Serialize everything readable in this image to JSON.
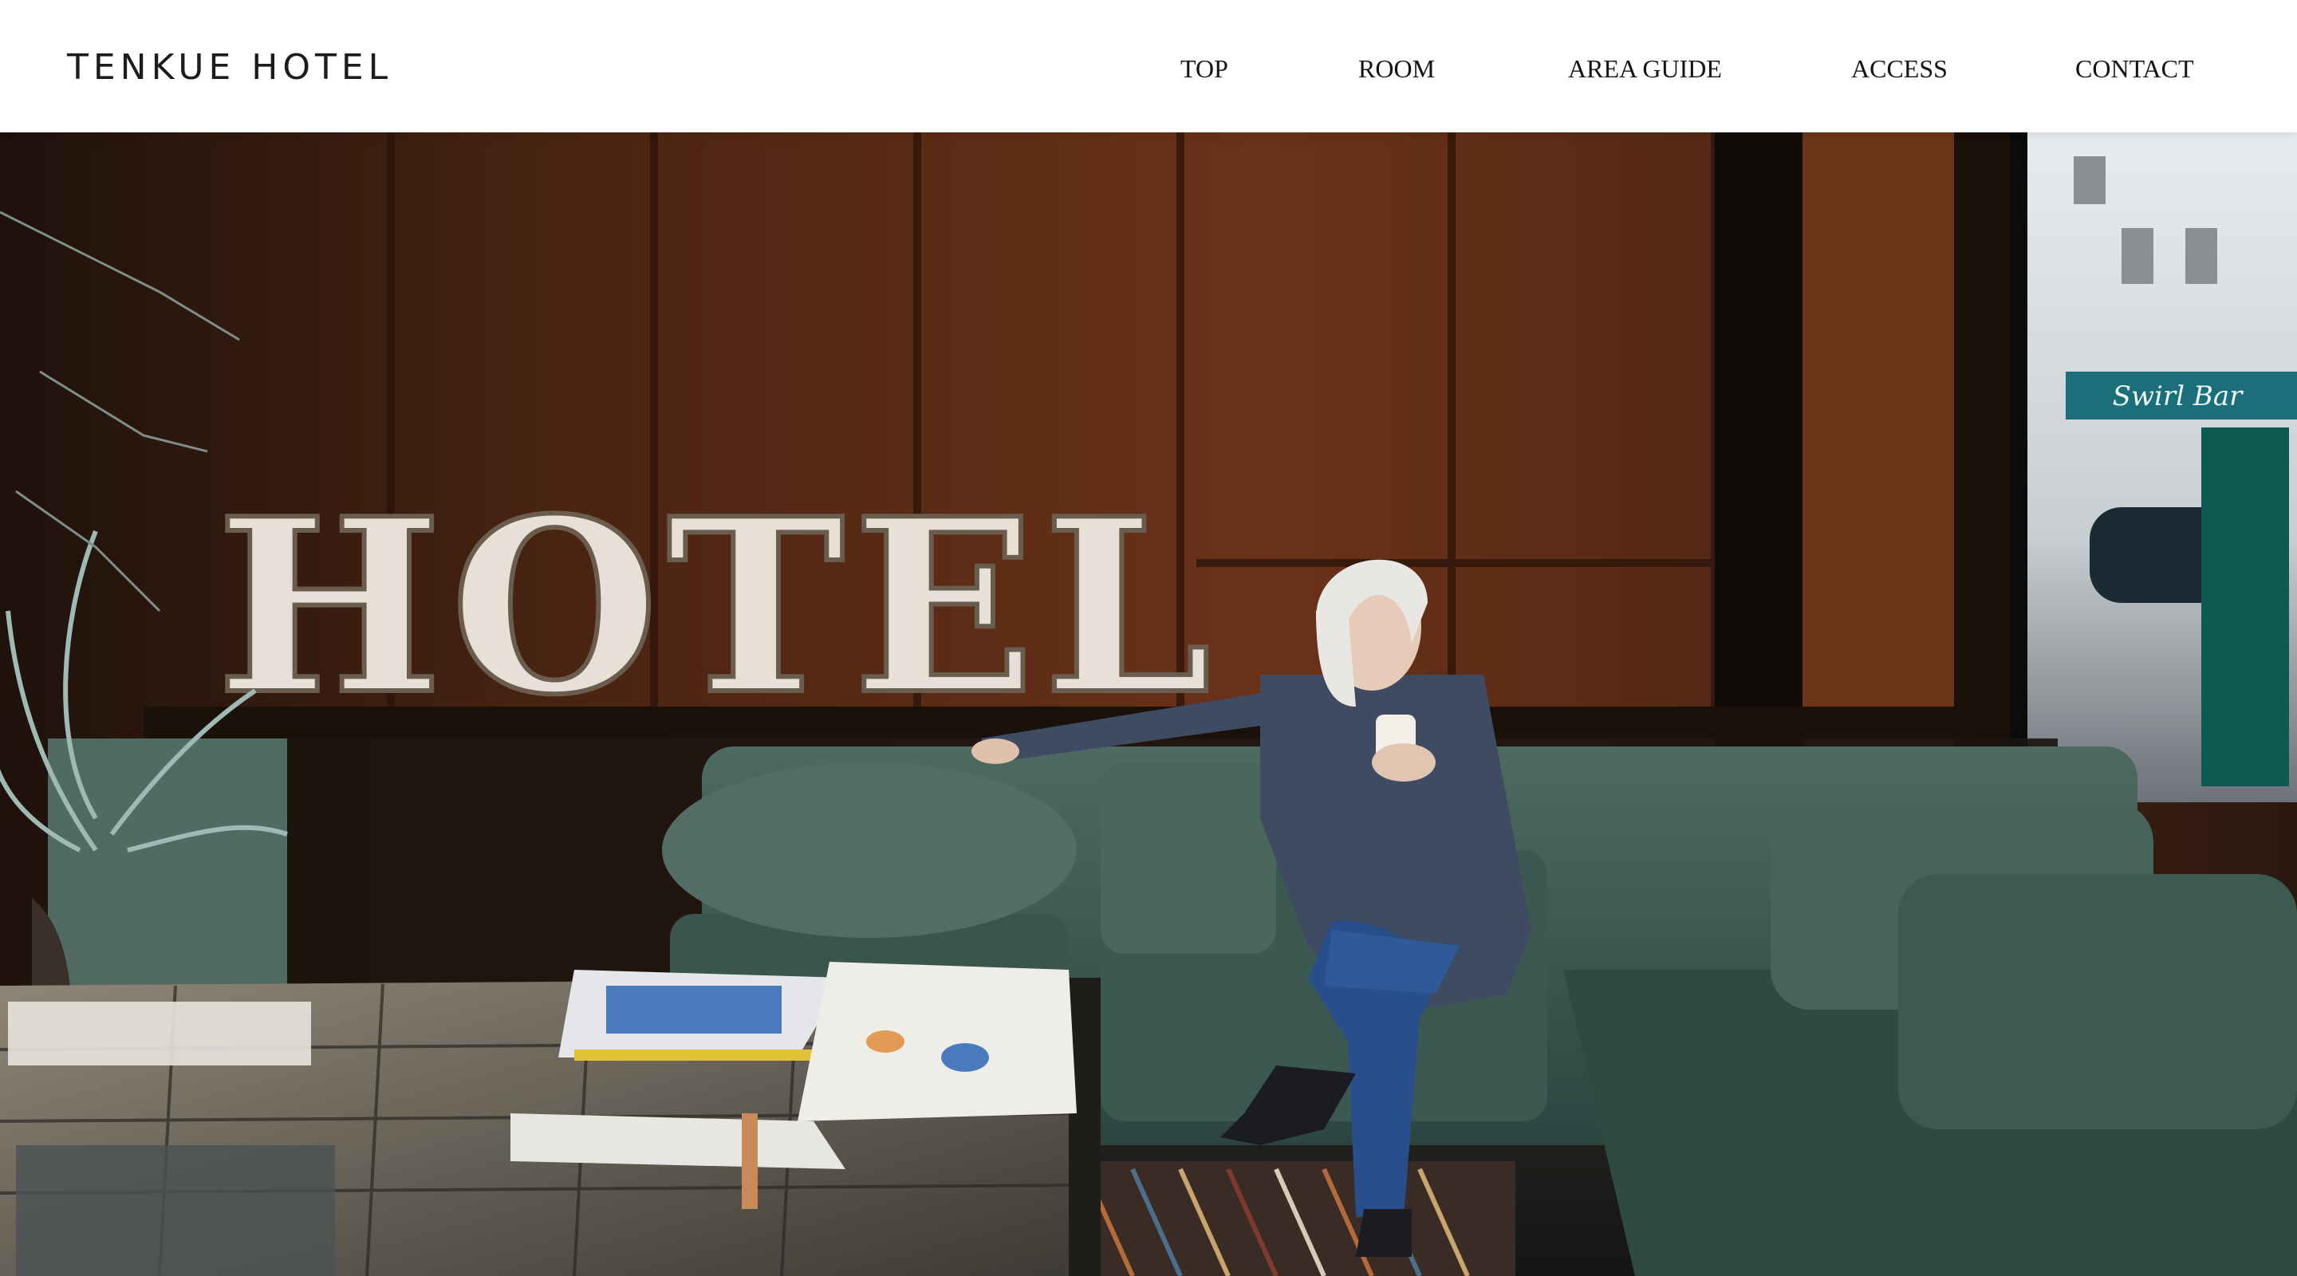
{
  "site": {
    "logo": "TENKUE HOTEL"
  },
  "nav": {
    "items": [
      {
        "label": "TOP"
      },
      {
        "label": "ROOM"
      },
      {
        "label": "AREA GUIDE"
      },
      {
        "label": "ACCESS"
      },
      {
        "label": "CONTACT"
      }
    ]
  },
  "hero": {
    "sign_text": "HOTEL",
    "storefront_sign": "Swirl Bar"
  },
  "colors": {
    "header_bg": "#ffffff",
    "text": "#141414",
    "wood": "#5a2c14",
    "sofa": "#3f5a50",
    "sign": "#e6e0d6"
  },
  "icons": [
    "hotel-sign-image",
    "woman-on-sofa-image",
    "newspaper-image"
  ]
}
